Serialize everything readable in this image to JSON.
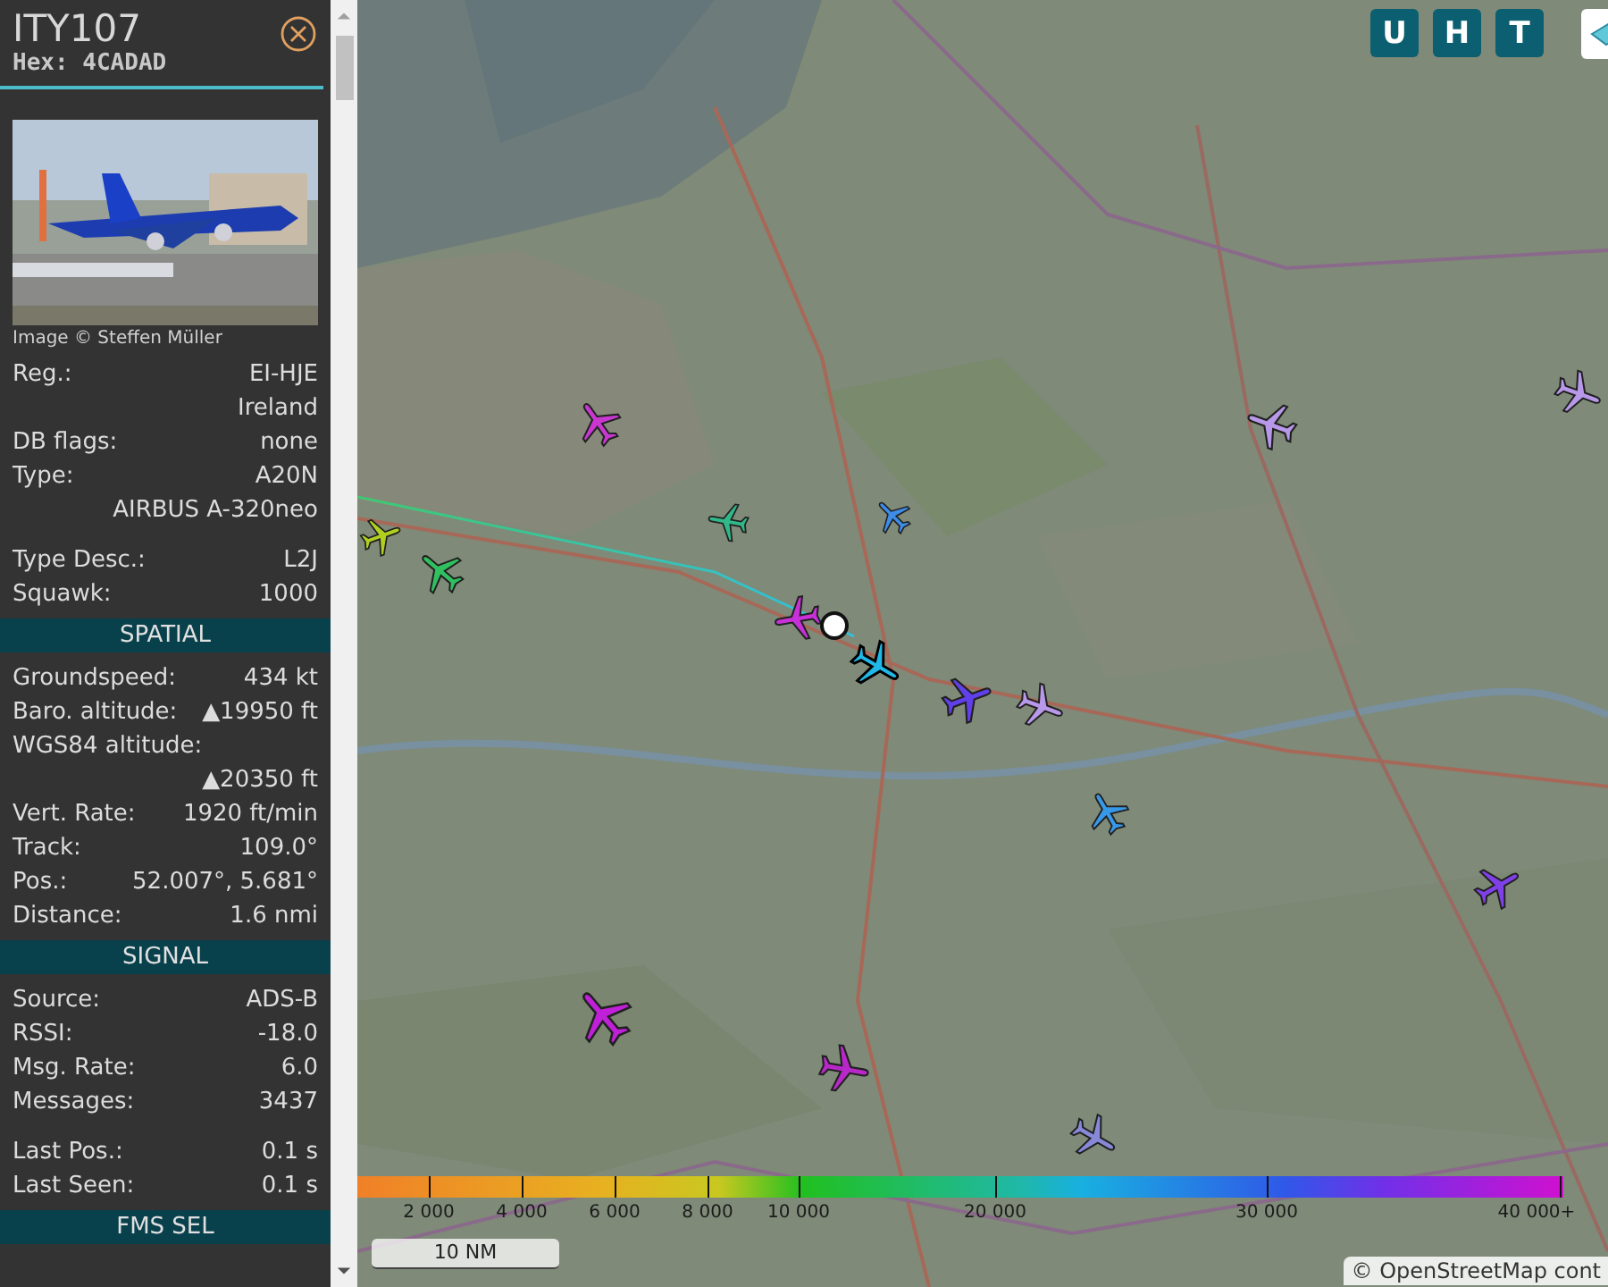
{
  "sidebar": {
    "callsign": "ITY107",
    "hex": "Hex: 4CADAD",
    "photo": {
      "kind": "picture",
      "credit": "Image © Steffen Müller"
    },
    "sections": [
      {
        "groups": [
          [
            {
              "label": "Reg.:",
              "value": "EI-HJE"
            },
            {
              "value": "Ireland"
            },
            {
              "label": "DB flags:",
              "value": "none"
            },
            {
              "label": "Type:",
              "value": "A20N"
            },
            {
              "value": "AIRBUS A-320neo"
            }
          ],
          [
            {
              "label": "Type Desc.:",
              "value": "L2J"
            },
            {
              "label": "Squawk:",
              "value": "1000"
            }
          ]
        ]
      },
      {
        "title": "SPATIAL",
        "groups": [
          [
            {
              "label": "Groundspeed:",
              "value": "434 kt"
            },
            {
              "label": "Baro. altitude:",
              "value": "▲19950 ft"
            },
            {
              "label": "WGS84 altitude:"
            },
            {
              "value": "▲20350 ft"
            },
            {
              "label": "Vert. Rate:",
              "value": "1920 ft/min"
            },
            {
              "label": "Track:",
              "value": "109.0°"
            },
            {
              "label": "Pos.:",
              "value": "52.007°, 5.681°"
            },
            {
              "label": "Distance:",
              "value": "1.6 nmi"
            }
          ]
        ]
      },
      {
        "title": "SIGNAL",
        "groups": [
          [
            {
              "label": "Source:",
              "value": "ADS-B"
            },
            {
              "label": "RSSI:",
              "value": "-18.0"
            },
            {
              "label": "Msg. Rate:",
              "value": "6.0"
            },
            {
              "label": "Messages:",
              "value": "3437"
            }
          ],
          [
            {
              "label": "Last Pos.:",
              "value": "0.1 s"
            },
            {
              "label": "Last Seen:",
              "value": "0.1 s"
            }
          ]
        ]
      },
      {
        "title": "FMS SEL"
      }
    ]
  },
  "map": {
    "kind": "picture",
    "toggle_buttons": [
      "U",
      "H",
      "T"
    ],
    "aircraft": [
      {
        "color": "#c838d0",
        "selected": false
      },
      {
        "color": "#30b888",
        "selected": false
      },
      {
        "color": "#3c8ce8",
        "selected": false
      },
      {
        "color": "#b0d020",
        "selected": false
      },
      {
        "color": "#30c060",
        "selected": false
      },
      {
        "color": "#c830d8",
        "selected": false
      },
      {
        "color": "#20b8e8",
        "selected": true
      },
      {
        "color": "#6040e8",
        "selected": false
      },
      {
        "color": "#b898e8",
        "selected": false
      },
      {
        "color": "#b898e8",
        "selected": false
      },
      {
        "color": "#b898e8",
        "selected": false
      },
      {
        "color": "#3898e8",
        "selected": false
      },
      {
        "color": "#8040e8",
        "selected": false
      },
      {
        "color": "#c020d8",
        "selected": false
      },
      {
        "color": "#b828c8",
        "selected": false
      },
      {
        "color": "#8888d8",
        "selected": false
      }
    ],
    "altitude_legend": [
      "2 000",
      "4 000",
      "6 000",
      "8 000",
      "10 000",
      "20 000",
      "30 000",
      "40 000+"
    ],
    "scale": "10 NM",
    "attribution": "© OpenStreetMap cont"
  }
}
